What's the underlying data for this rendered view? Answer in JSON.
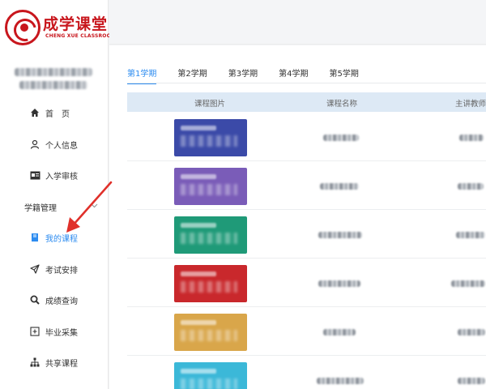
{
  "brand": {
    "title": "成学课堂",
    "subtitle": "CHENG XUE CLASSROOM"
  },
  "sidebar": {
    "menu": [
      {
        "label": "首　页",
        "icon": "home-icon"
      },
      {
        "label": "个人信息",
        "icon": "user-icon"
      },
      {
        "label": "入学审核",
        "icon": "id-card-icon"
      },
      {
        "label": "学籍管理",
        "icon": "chevron-down-icon",
        "group": true
      },
      {
        "label": "我的课程",
        "icon": "book-icon",
        "active": true
      },
      {
        "label": "考试安排",
        "icon": "paper-plane-icon"
      },
      {
        "label": "成绩查询",
        "icon": "search-icon"
      },
      {
        "label": "毕业采集",
        "icon": "plus-square-icon"
      },
      {
        "label": "共享课程",
        "icon": "sitemap-icon"
      }
    ]
  },
  "tabs": [
    {
      "label": "第1学期",
      "active": true
    },
    {
      "label": "第2学期"
    },
    {
      "label": "第3学期"
    },
    {
      "label": "第4学期"
    },
    {
      "label": "第5学期"
    }
  ],
  "table": {
    "columns": [
      "课程图片",
      "课程名称",
      "主讲教师"
    ]
  },
  "colors": {
    "accent": "#2d8cf0",
    "brand": "#c8161d",
    "annotation": "#e0302a",
    "course_images": [
      "#3b4aa8",
      "#7a5cb8",
      "#1f9a78",
      "#c9282c",
      "#d9a64a",
      "#3bb8d8"
    ]
  }
}
